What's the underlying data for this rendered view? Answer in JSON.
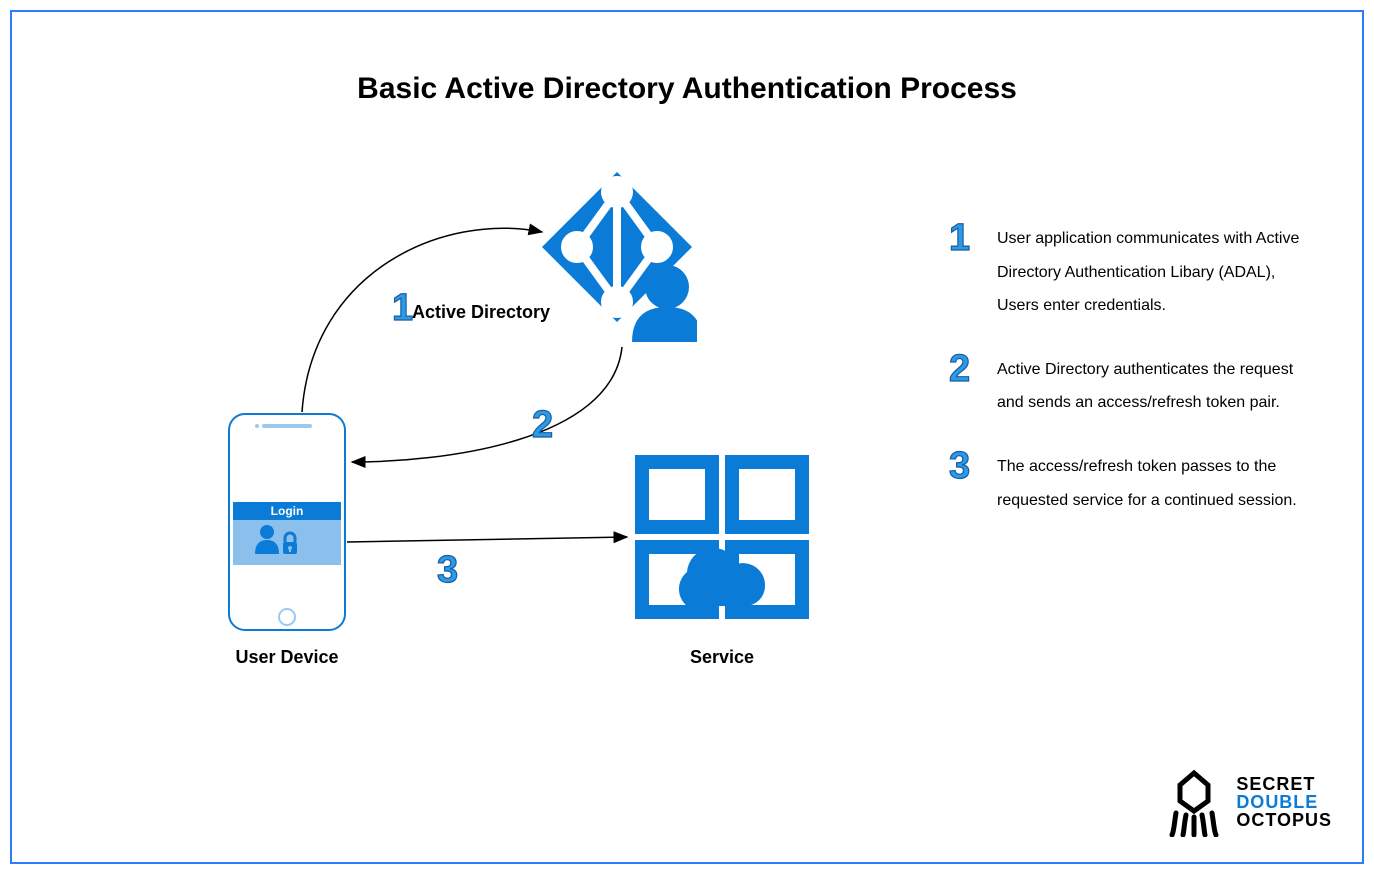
{
  "title": "Basic Active Directory Authentication Process",
  "nodes": {
    "user_device": "User Device",
    "active_directory": "Active Directory",
    "service": "Service",
    "login": "Login"
  },
  "flow": {
    "step1_num": "1",
    "step2_num": "2",
    "step3_num": "3"
  },
  "steps": {
    "s1": {
      "num": "1",
      "text": "User application communicates with Active Directory Authentication Libary (ADAL), Users enter credentials."
    },
    "s2": {
      "num": "2",
      "text": "Active Directory authenticates the request and sends an access/refresh token pair."
    },
    "s3": {
      "num": "3",
      "text": "The access/refresh token passes to the requested service for a continued session."
    }
  },
  "brand": {
    "line1": "SECRET",
    "line2": "DOUBLE",
    "line3": "OCTOPUS"
  },
  "colors": {
    "accent": "#0b7bd8",
    "border": "#2b7cff",
    "number_fill": "#2b9be6",
    "number_stroke": "#1a5ba0"
  }
}
